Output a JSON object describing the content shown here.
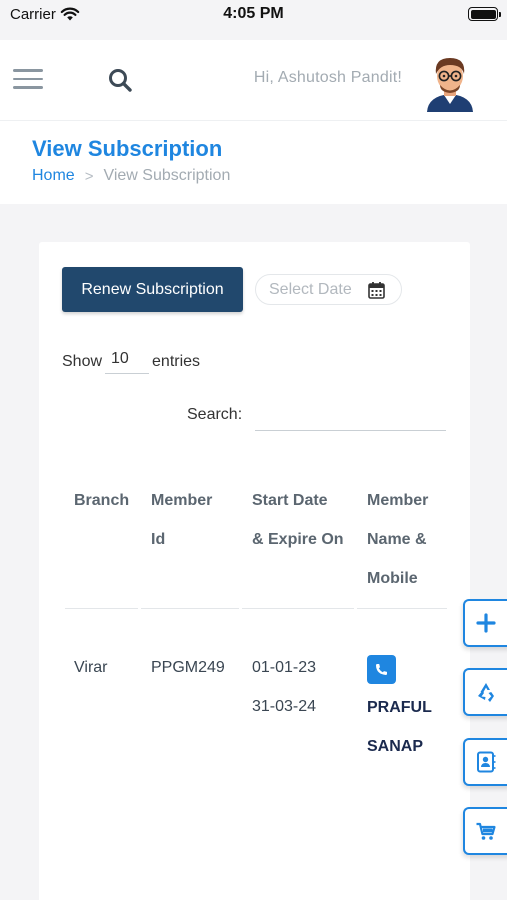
{
  "status_bar": {
    "carrier": "Carrier",
    "time": "4:05 PM"
  },
  "header": {
    "greeting": "Hi, Ashutosh Pandit!"
  },
  "page": {
    "title": "View Subscription",
    "breadcrumb": {
      "home": "Home",
      "separator": ">",
      "current": "View Subscription"
    }
  },
  "toolbar": {
    "renew_label": "Renew Subscription",
    "date_placeholder": "Select Date"
  },
  "entries": {
    "show_label": "Show",
    "value": "10",
    "entries_label": "entries"
  },
  "search": {
    "label": "Search:",
    "value": ""
  },
  "table": {
    "headers": {
      "branch": "Branch",
      "member_id": [
        "Member",
        "Id"
      ],
      "dates": [
        "Start Date",
        "& Expire On"
      ],
      "member": [
        "Member",
        "Name &",
        "Mobile"
      ]
    },
    "rows": [
      {
        "branch": "Virar",
        "member_id": "PPGM249",
        "start_date": "01-01-23",
        "expire_date": "31-03-24",
        "member_name": [
          "PRAFUL",
          "SANAP"
        ]
      }
    ]
  },
  "side_actions": [
    "plus-icon",
    "recycle-icon",
    "contact-card-icon",
    "cart-icon"
  ],
  "colors": {
    "accent": "#1f86e0",
    "button_dark": "#21486d",
    "name_dark": "#1b2a4e"
  }
}
